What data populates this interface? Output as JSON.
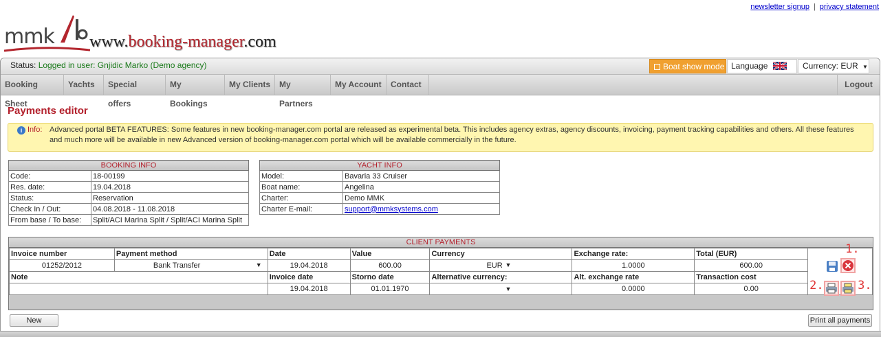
{
  "top_links": {
    "newsletter": "newsletter signup",
    "separator": "|",
    "privacy": "privacy statement"
  },
  "logo": {
    "brand": "mmk",
    "url_prefix": "www.",
    "url_brand": "booking-manager",
    "url_suffix": ".com"
  },
  "status": {
    "label": "Status:",
    "value": "Logged in user: Gnjidic Marko (Demo agency)"
  },
  "boat_show": "Boat show mode",
  "language": {
    "label": "Language",
    "flag": "uk-flag-icon"
  },
  "currency": {
    "label": "Currency: EUR"
  },
  "nav": [
    "Booking Sheet",
    "Yachts",
    "Special offers",
    "My Bookings",
    "My Clients",
    "My Partners",
    "My Account",
    "Contact"
  ],
  "logout": "Logout",
  "page_title": "Payments editor",
  "info": {
    "label": "Info:",
    "line1": "Advanced portal BETA FEATURES: Some features in new booking-manager.com portal are released as experimental beta. This includes agency extras, agency discounts, invoicing, payment tracking capabilities and others. All these features",
    "line2": "and much more will be available in new Advanced version of booking-manager.com portal which will be available commercially in the future."
  },
  "booking_info": {
    "title": "BOOKING INFO",
    "rows": [
      {
        "k": "Code:",
        "v": "18-00199"
      },
      {
        "k": "Res. date:",
        "v": "19.04.2018"
      },
      {
        "k": "Status:",
        "v": "Reservation"
      },
      {
        "k": "Check In / Out:",
        "v": "04.08.2018 - 11.08.2018"
      },
      {
        "k": "From base / To base:",
        "v": "Split/ACI Marina Split / Split/ACI Marina Split"
      }
    ]
  },
  "yacht_info": {
    "title": "YACHT INFO",
    "rows": [
      {
        "k": "Model:",
        "v": "Bavaria 33 Cruiser"
      },
      {
        "k": "Boat name:",
        "v": "Angelina"
      },
      {
        "k": "Charter:",
        "v": "Demo MMK"
      },
      {
        "k": "Charter E-mail:",
        "v": "support@mmksystems.com"
      }
    ]
  },
  "client_payments": {
    "title": "CLIENT PAYMENTS",
    "headers1": [
      "Invoice number",
      "Payment method",
      "Date",
      "Value",
      "Currency",
      "Exchange rate:",
      "Total (EUR)"
    ],
    "row1": {
      "invoice_number": "01252/2012",
      "payment_method": "Bank Transfer",
      "date": "19.04.2018",
      "value": "600.00",
      "currency": "EUR",
      "exchange_rate": "1.0000",
      "total": "600.00"
    },
    "headers2": [
      "Note",
      "Invoice date",
      "Storno date",
      "Alternative currency:",
      "Alt. exchange rate",
      "Transaction cost"
    ],
    "row2": {
      "note": "",
      "invoice_date": "19.04.2018",
      "storno_date": "01.01.1970",
      "alt_currency": "",
      "alt_exchange_rate": "0.0000",
      "transaction_cost": "0.00"
    },
    "markers": {
      "m1": "1.",
      "m2": "2.",
      "m3": "3."
    }
  },
  "buttons": {
    "new": "New",
    "print_all": "Print all payments"
  },
  "colors": {
    "accent_red": "#b3202c",
    "boat_show_orange": "#f0a030",
    "info_bg": "#fff6b0",
    "status_green": "#1a7a1a",
    "annotation_red": "#e03434"
  }
}
